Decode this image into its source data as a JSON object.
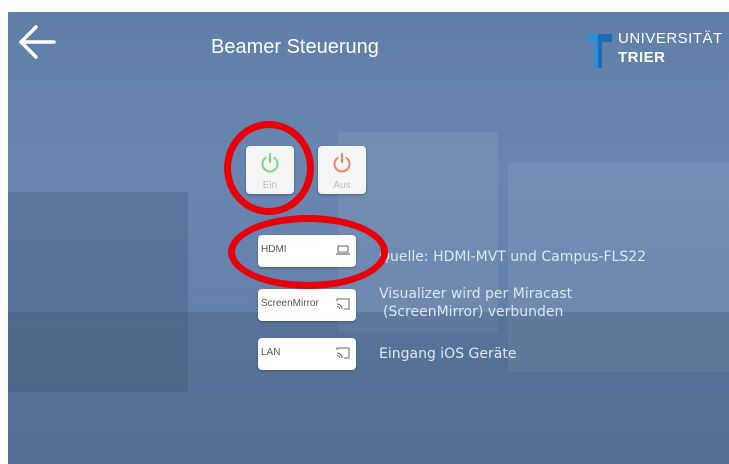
{
  "header": {
    "title": "Beamer Steuerung",
    "logo_line1": "UNIVERSITÄT",
    "logo_line2": "TRIER"
  },
  "power": {
    "on_label": "Ein",
    "off_label": "Aus",
    "on_color": "#7dd87d",
    "off_color": "#f0826a"
  },
  "sources": [
    {
      "label": "HDMI",
      "icon": "laptop-icon",
      "description": "Quelle: HDMI-MVT und Campus-FLS22"
    },
    {
      "label": "ScreenMirror",
      "icon": "cast-icon",
      "description_line1": "Visualizer wird per Miracast",
      "description_line2": "(ScreenMirror) verbunden"
    },
    {
      "label": "LAN",
      "icon": "cast-icon",
      "description": "Eingang iOS Geräte"
    }
  ],
  "annotation_color": "#e8000b"
}
